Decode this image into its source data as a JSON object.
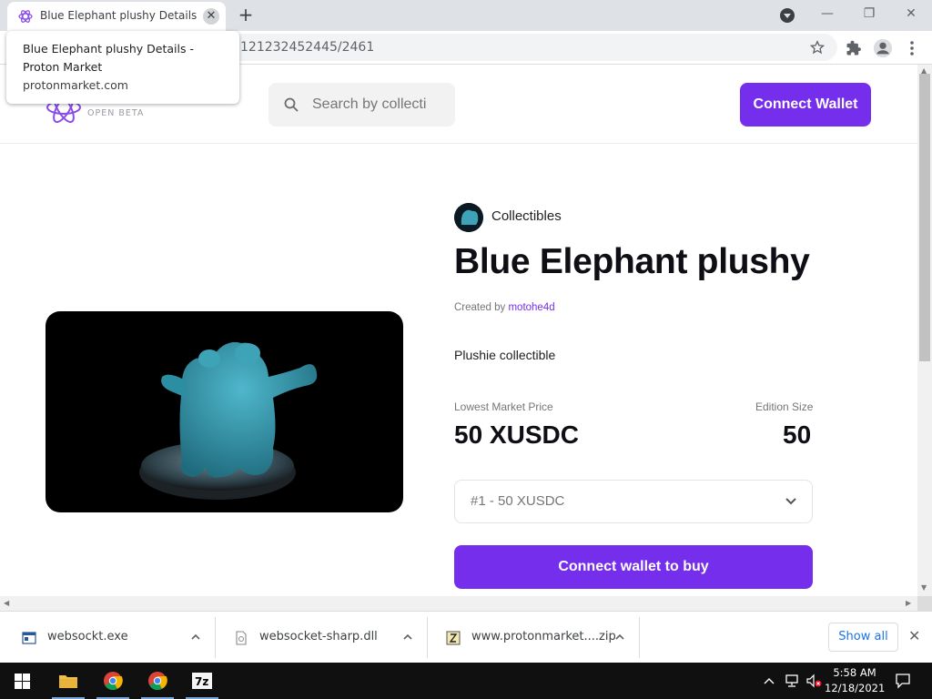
{
  "browser": {
    "tab_title": "Blue Elephant plushy Details - Proton Market",
    "new_tab": "+",
    "tab_close": "✕",
    "url": "121232452445/2461",
    "tooltip": {
      "title": "Blue Elephant plushy Details - Proton Market",
      "domain": "protonmarket.com"
    },
    "window": {
      "minimize": "—",
      "restore": "❐",
      "close": "✕"
    }
  },
  "header": {
    "logo_subtitle": "OPEN BETA",
    "search_placeholder": "Search by collecti",
    "connect_wallet_label": "Connect Wallet"
  },
  "nft": {
    "collection": "Collectibles",
    "title": "Blue Elephant plushy",
    "created_by_prefix": "Created by",
    "creator": "motohe4d",
    "description": "Plushie collectible",
    "price_label": "Lowest Market Price",
    "price_value": "50 XUSDC",
    "edition_label": "Edition Size",
    "edition_value": "50",
    "select_value": "#1 - 50 XUSDC",
    "buy_label": "Connect wallet to buy"
  },
  "downloads": {
    "items": [
      {
        "name": "websockt.exe"
      },
      {
        "name": "websocket-sharp.dll"
      },
      {
        "name": "www.protonmarket....zip"
      }
    ],
    "show_all": "Show all",
    "close": "✕"
  },
  "taskbar": {
    "time": "5:58 AM",
    "date": "12/18/2021"
  },
  "colors": {
    "accent": "#752eeb",
    "plushy": "#3fa3b8"
  }
}
